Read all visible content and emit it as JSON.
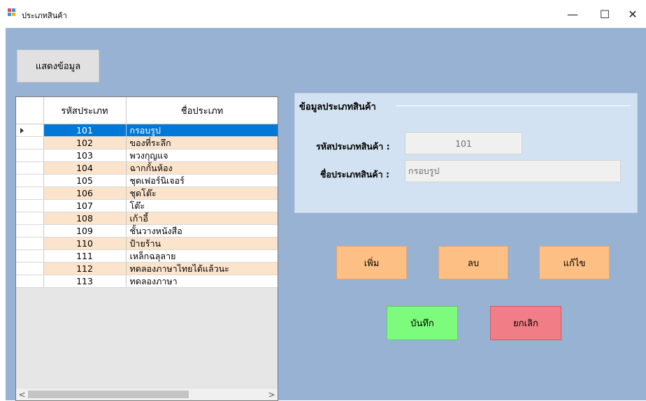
{
  "window": {
    "title": "ประเภทสินค้า",
    "controls": {
      "minimize": "—",
      "maximize": "☐",
      "close": "✕"
    }
  },
  "toolbar": {
    "show_data_label": "แสดงข้อมูล"
  },
  "grid": {
    "columns": [
      "รหัสประเภท",
      "ชื่อประเภท"
    ],
    "rows": [
      {
        "id": "101",
        "name": "กรอบรูป"
      },
      {
        "id": "102",
        "name": "ของที่ระลึก"
      },
      {
        "id": "103",
        "name": "พวงกุญแจ"
      },
      {
        "id": "104",
        "name": "ฉากกั้นห้อง"
      },
      {
        "id": "105",
        "name": "ชุดเฟอร์นิเจอร์"
      },
      {
        "id": "106",
        "name": "ชุดโต๊ะ"
      },
      {
        "id": "107",
        "name": "โต๊ะ"
      },
      {
        "id": "108",
        "name": "เก้าอี้"
      },
      {
        "id": "109",
        "name": "ชั้นวางหนังสือ"
      },
      {
        "id": "110",
        "name": "ป้ายร้าน"
      },
      {
        "id": "111",
        "name": "เหล็กฉลุลาย"
      },
      {
        "id": "112",
        "name": "ทดลองภาษาไทยได้แล้วนะ"
      },
      {
        "id": "113",
        "name": "ทดลองภาษา"
      }
    ],
    "selected_index": 0,
    "scroll": {
      "left_arrow": "<",
      "right_arrow": ">"
    }
  },
  "details": {
    "title": "ข้อมูลประเภทสินค้า",
    "code_label": "รหัสประเภทสินค้า :",
    "code_value": "101",
    "name_label": "ชื่อประเภทสินค้า :",
    "name_value": "กรอบรูป"
  },
  "actions": {
    "add": "เพิ่ม",
    "delete": "ลบ",
    "edit": "แก้ไข",
    "save": "บันทึก",
    "cancel": "ยกเลิก"
  },
  "colors": {
    "form_background": "#98b2d3",
    "row_alt": "#fce4cc",
    "selection": "#0078d7",
    "orange_button": "#fdbf84",
    "save_button": "#7cfb7c",
    "cancel_button": "#f17d86"
  }
}
